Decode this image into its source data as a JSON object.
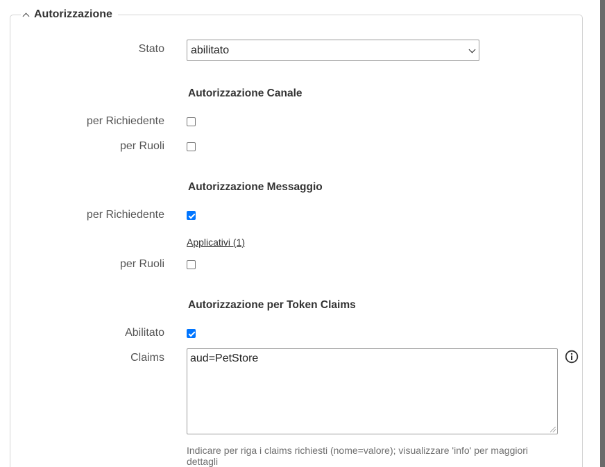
{
  "fieldset": {
    "title": "Autorizzazione"
  },
  "stato": {
    "label": "Stato",
    "selected": "abilitato"
  },
  "canale": {
    "section_title": "Autorizzazione Canale",
    "per_richiedente": {
      "label": "per Richiedente",
      "checked": false
    },
    "per_ruoli": {
      "label": "per Ruoli",
      "checked": false
    }
  },
  "messaggio": {
    "section_title": "Autorizzazione Messaggio",
    "per_richiedente": {
      "label": "per Richiedente",
      "checked": true
    },
    "applicativi_link": "Applicativi (1)",
    "per_ruoli": {
      "label": "per Ruoli",
      "checked": false
    }
  },
  "token_claims": {
    "section_title": "Autorizzazione per Token Claims",
    "abilitato": {
      "label": "Abilitato",
      "checked": true
    },
    "claims": {
      "label": "Claims",
      "value": "aud=PetStore",
      "hint": "Indicare per riga i claims richiesti (nome=valore); visualizzare 'info' per maggiori dettagli"
    }
  },
  "icons": {
    "legend": "chevron-up-icon",
    "info": "info-icon"
  },
  "colors": {
    "checkbox_checked": "#0075ff",
    "border": "#d3d3d3"
  }
}
